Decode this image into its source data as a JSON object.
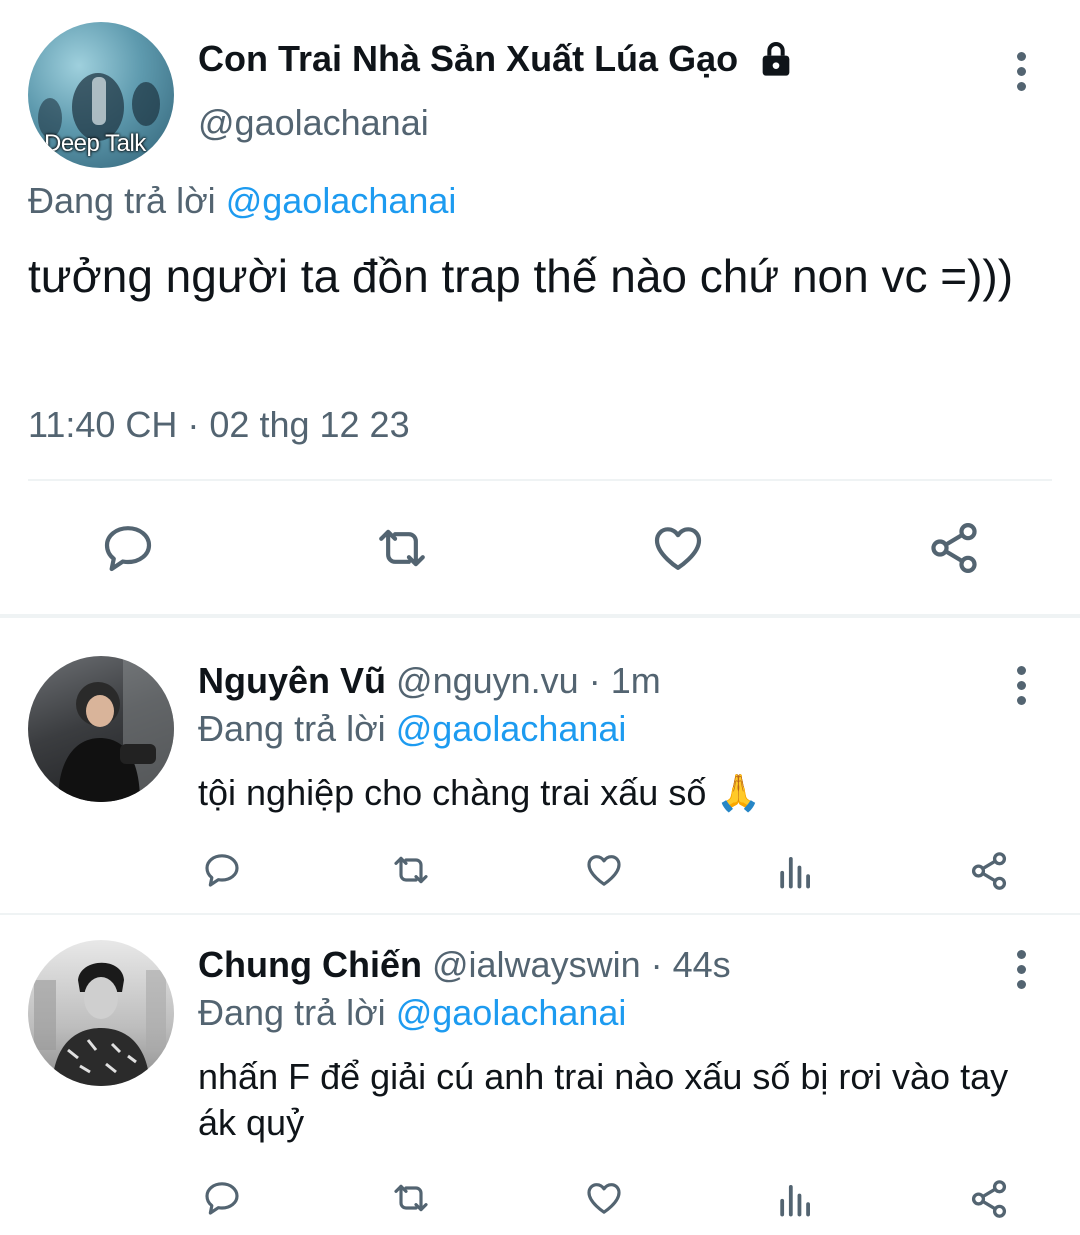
{
  "main_tweet": {
    "author": {
      "display_name": "Con Trai Nhà Sản Xuất Lúa Gạo",
      "handle": "@gaolachanai",
      "avatar_caption": "Deep Talk",
      "lock_icon": "lock-icon"
    },
    "reply_prefix": "Đang trả lời",
    "reply_to": "@gaolachanai",
    "text": "tưởng người ta đồn trap thế nào chứ non vc =)))",
    "timestamp": "11:40 CH · 02 thg 12 23",
    "actions": [
      "reply-icon",
      "retweet-icon",
      "like-icon",
      "share-icon"
    ]
  },
  "replies": [
    {
      "display_name": "Nguyên Vũ",
      "handle": "@nguyn.vu",
      "time": "· 1m",
      "reply_prefix": "Đang trả lời",
      "reply_to": "@gaolachanai",
      "text": "tội nghiệp cho chàng trai xấu số 🙏",
      "actions": [
        "reply-icon",
        "retweet-icon",
        "like-icon",
        "views-icon",
        "share-icon"
      ]
    },
    {
      "display_name": "Chung Chiến",
      "handle": "@ialwayswin",
      "time": "· 44s",
      "reply_prefix": "Đang trả lời",
      "reply_to": "@gaolachanai",
      "text": "nhấn F để giải cú anh trai nào xấu số bị rơi vào tay ák quỷ",
      "actions": [
        "reply-icon",
        "retweet-icon",
        "like-icon",
        "views-icon",
        "share-icon"
      ]
    }
  ],
  "colors": {
    "text": "#0f1419",
    "muted": "#536471",
    "link": "#1d9bf0",
    "divider": "#e6ecf0"
  }
}
